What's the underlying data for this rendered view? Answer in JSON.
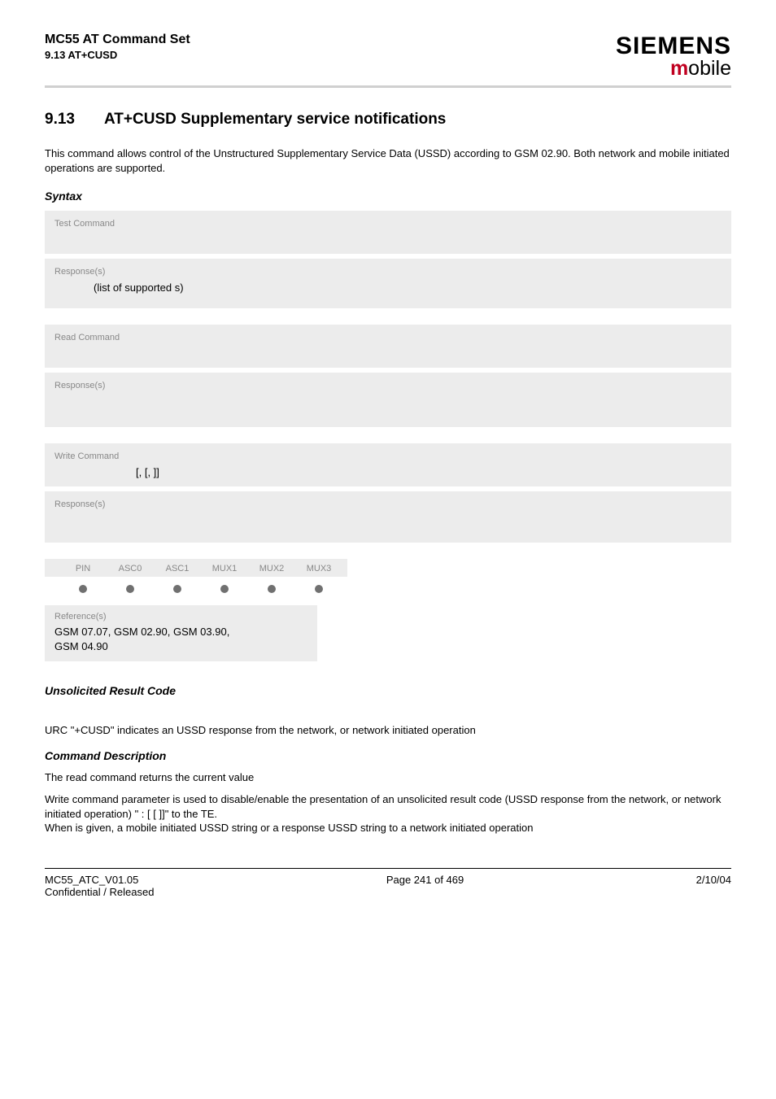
{
  "header": {
    "title": "MC55 AT Command Set",
    "sub": "9.13 AT+CUSD",
    "brand": "SIEMENS",
    "brand_sub_m": "m",
    "brand_sub_rest": "obile"
  },
  "section": {
    "number": "9.13",
    "title": "AT+CUSD   Supplementary service notifications"
  },
  "intro": "This command allows control of the Unstructured Supplementary Service Data (USSD) according to GSM 02.90. Both network and mobile initiated operations are supported.",
  "syntax_label": "Syntax",
  "blocks": {
    "test_label": "Test Command",
    "test_resp_label": "Response(s)",
    "test_resp_body": "(list of supported      s)",
    "read_label": "Read Command",
    "read_resp_label": "Response(s)",
    "write_label": "Write Command",
    "write_body": "[,           [,          ]]",
    "write_resp_label": "Response(s)"
  },
  "pin_headers": [
    "PIN",
    "ASC0",
    "ASC1",
    "MUX1",
    "MUX2",
    "MUX3"
  ],
  "refs": {
    "label": "Reference(s)",
    "body_line1": "GSM 07.07,      GSM 02.90,      GSM 03.90,",
    "body_line2": "GSM 04.90"
  },
  "urc_label": "Unsolicited Result Code",
  "urc_body": "URC \"+CUSD\" indicates an USSD response from the network, or network initiated operation",
  "cmd_desc_label": "Command Description",
  "cmd_desc_1": "The read command returns the current        value",
  "cmd_desc_2": "Write command parameter        is used to disable/enable the presentation of an unsolicited result code (USSD response from the network, or network initiated operation) \"          :        [          [          ]]\" to the TE.",
  "cmd_desc_3": "When            is given, a mobile initiated USSD string or a response USSD string to a network initiated operation",
  "footer": {
    "left1": "MC55_ATC_V01.05",
    "left2": "Confidential / Released",
    "center": "Page 241 of 469",
    "right": "2/10/04"
  }
}
